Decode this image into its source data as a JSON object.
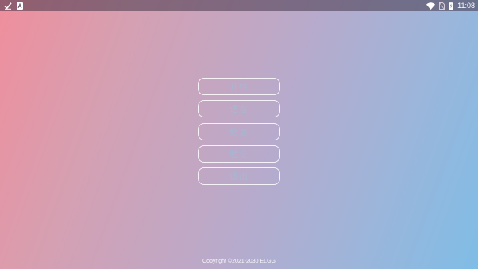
{
  "status_bar": {
    "time": "11:08",
    "left_icons": [
      "check-icon",
      "a-notification-icon"
    ],
    "right_icons": [
      "wifi-icon",
      "no-sim-icon",
      "battery-icon"
    ]
  },
  "menu": {
    "start": "开始",
    "language": "语言",
    "repair": "修复",
    "verify": "验证",
    "exit": "退出"
  },
  "footer": {
    "copyright": "Copyright ©2021-2030 ELGG"
  },
  "colors": {
    "gradient_left": "#f08e9c",
    "gradient_right": "#7fbde6",
    "button_text": "#a6b8d2",
    "button_border": "#ffffff"
  }
}
